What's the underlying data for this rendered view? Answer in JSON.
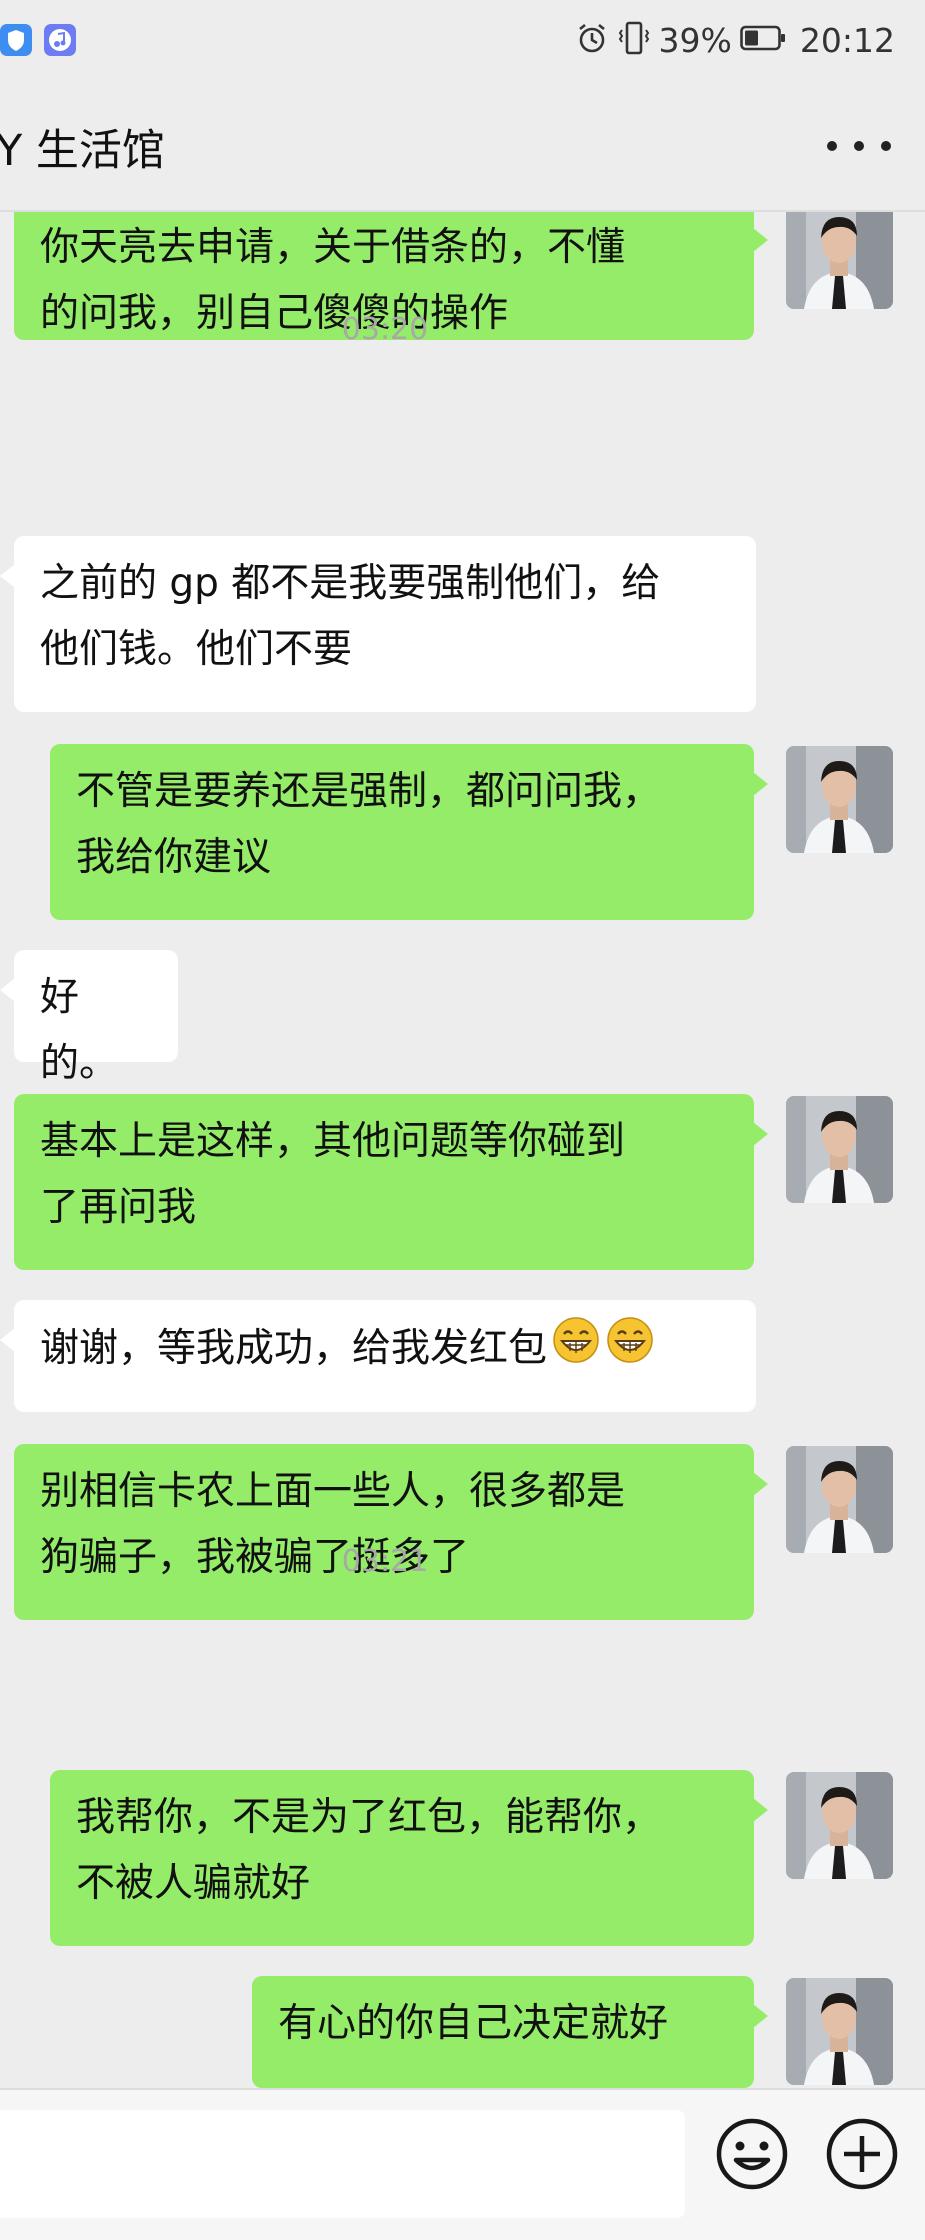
{
  "status_bar": {
    "battery_percent": "39%",
    "time": "20:12",
    "icons": [
      "shield-app-icon",
      "music-app-icon",
      "alarm-icon",
      "vibrate-icon",
      "battery-icon"
    ]
  },
  "header": {
    "title": "Y 生活馆",
    "more_icon": "more-dots-icon"
  },
  "messages": [
    {
      "type": "msg",
      "direction": "out",
      "text": "你天亮去申请，关于借条的，不懂\n的问我，别自己傻傻的操作"
    },
    {
      "type": "time",
      "text": "03:20"
    },
    {
      "type": "msg",
      "direction": "in",
      "text": "之前的 gp 都不是我要强制他们，给\n他们钱。他们不要"
    },
    {
      "type": "msg",
      "direction": "out",
      "text": "不管是要养还是强制，都问问我，\n我给你建议"
    },
    {
      "type": "msg",
      "direction": "in",
      "text": "好的。"
    },
    {
      "type": "msg",
      "direction": "out",
      "text": "基本上是这样，其他问题等你碰到\n了再问我"
    },
    {
      "type": "msg",
      "direction": "in",
      "text": "谢谢，等我成功，给我发红包",
      "emoji_count": 2
    },
    {
      "type": "msg",
      "direction": "out",
      "text": "别相信卡农上面一些人，很多都是\n狗骗子，我被骗了挺多了"
    },
    {
      "type": "time",
      "text": "03:21"
    },
    {
      "type": "msg",
      "direction": "out",
      "text": "我帮你，不是为了红包，能帮你，\n不被人骗就好"
    },
    {
      "type": "msg",
      "direction": "out",
      "text": "有心的你自己决定就好"
    }
  ],
  "input_bar": {
    "emoji_icon": "smiley-icon",
    "plus_icon": "plus-circle-icon"
  },
  "colors": {
    "outgoing_bubble": "#95ec69",
    "incoming_bubble": "#ffffff",
    "background": "#ededed"
  }
}
